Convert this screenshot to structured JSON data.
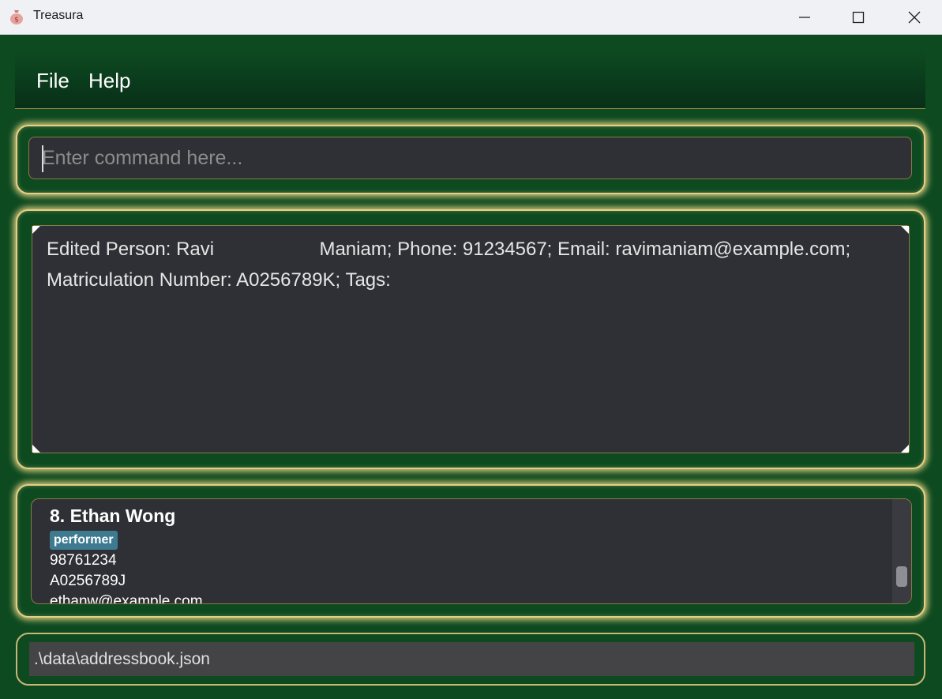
{
  "window": {
    "title": "Treasura",
    "icon": "money-bag-icon",
    "controls": [
      "minimize-icon",
      "maximize-icon",
      "close-icon"
    ]
  },
  "menu": {
    "items": [
      {
        "label": "File"
      },
      {
        "label": "Help"
      }
    ]
  },
  "command": {
    "value": "",
    "placeholder": "Enter command here..."
  },
  "result": {
    "text": "Edited Person: Ravi                    Maniam; Phone: 91234567; Email: ravimaniam@example.com;\nMatriculation Number: A0256789K; Tags:"
  },
  "person_list": {
    "cards": [
      {
        "name": "8. Ethan Wong",
        "tags": [
          "performer"
        ],
        "phone": "98761234",
        "matric": "A0256789J",
        "email": "ethanw@example.com"
      }
    ]
  },
  "status": {
    "file_path": ".\\data\\addressbook.json"
  },
  "colors": {
    "background": "#0d4a20",
    "panel_border": "#e6cf84",
    "field_bg": "#2f3035",
    "tag_bg": "#3e7b91"
  }
}
